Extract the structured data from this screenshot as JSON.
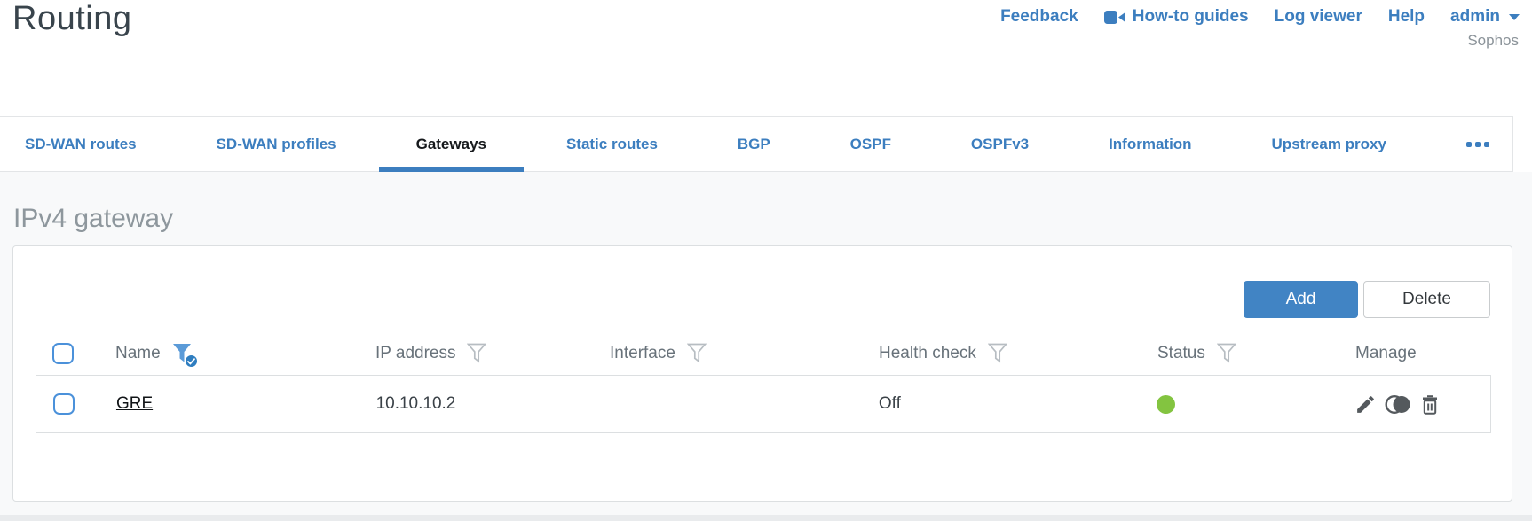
{
  "page": {
    "title": "Routing",
    "brand": "Sophos"
  },
  "header_links": [
    {
      "label": "Feedback"
    },
    {
      "label": "How-to guides",
      "icon": "video-camera-icon"
    },
    {
      "label": "Log viewer"
    },
    {
      "label": "Help"
    },
    {
      "label": "admin",
      "icon": "caret-down-icon"
    }
  ],
  "tabs": [
    {
      "label": "SD-WAN routes",
      "active": false
    },
    {
      "label": "SD-WAN profiles",
      "active": false
    },
    {
      "label": "Gateways",
      "active": true
    },
    {
      "label": "Static routes",
      "active": false
    },
    {
      "label": "BGP",
      "active": false
    },
    {
      "label": "OSPF",
      "active": false
    },
    {
      "label": "OSPFv3",
      "active": false
    },
    {
      "label": "Information",
      "active": false
    },
    {
      "label": "Upstream proxy",
      "active": false
    }
  ],
  "tabs_overflow_icon": "ellipsis-icon",
  "section": {
    "heading": "IPv4 gateway"
  },
  "toolbar": {
    "add_label": "Add",
    "delete_label": "Delete"
  },
  "table": {
    "columns": [
      {
        "label": "Name",
        "filter": "active"
      },
      {
        "label": "IP address",
        "filter": "default"
      },
      {
        "label": "Interface",
        "filter": "default"
      },
      {
        "label": "Health check",
        "filter": "default"
      },
      {
        "label": "Status",
        "filter": "default"
      },
      {
        "label": "Manage",
        "filter": "none"
      }
    ],
    "rows": [
      {
        "name": "GRE",
        "ip_address": "10.10.10.2",
        "interface": "",
        "health_check": "Off",
        "status": "up",
        "status_color": "#83c440",
        "actions": [
          "edit",
          "toggle-active",
          "delete"
        ]
      }
    ]
  },
  "colors": {
    "link_blue": "#3c7ebf",
    "button_blue": "#4184c4",
    "checkbox_blue": "#4b91da",
    "funnel_active_blue": "#5b9bd8",
    "badge_blue": "#2f7ec0",
    "status_green": "#83c440",
    "icon_gray": "#54595d",
    "header_text_gray": "#68727a",
    "heading_gray": "#8e979d",
    "title_dark": "#39444c"
  }
}
